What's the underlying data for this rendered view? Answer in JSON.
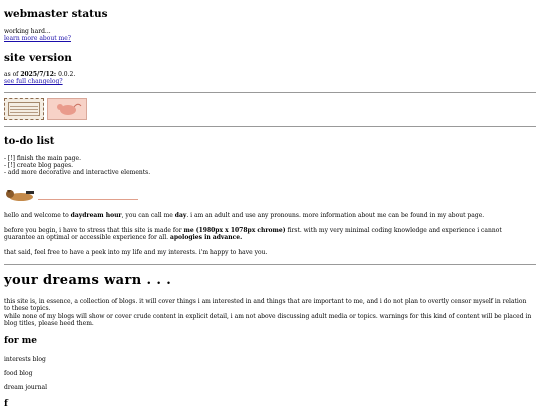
{
  "webmaster": {
    "title": "webmaster status",
    "status": "working hard...",
    "link": "learn more about me?"
  },
  "version": {
    "title": "site version",
    "as_of_prefix": "as of",
    "date": "2025/7/12:",
    "number": "0.0.2.",
    "link": "see full changelog?"
  },
  "badges": [
    {
      "name": "stamp-badge",
      "icon": "postage-stamp"
    },
    {
      "name": "pink-creature-badge",
      "icon": "pink-creature"
    }
  ],
  "todo": {
    "title": "to-do list",
    "items": [
      "- [!] finish the main page.",
      "- [!] create blog pages.",
      "- add more decorative and interactive elements."
    ]
  },
  "intro": {
    "p1_a": "hello and welcome to",
    "p1_b": "daydream hour",
    "p1_c": ", you can call me",
    "p1_d": "day",
    "p1_e": ". i am an adult and use any pronouns. more information about me can be found in my about page.",
    "p2_a": "before you begin, i have to stress that this site is made for",
    "p2_b": "me (1980px x 1078px chrome)",
    "p2_c": "first. with my very minimal coding knowledge and experience i cannot guarantee an optimal or accessible experience for all.",
    "p2_d": "apologies in advance.",
    "p3": "that said, feel free to have a peek into my life and my interests. i'm happy to have you."
  },
  "main": {
    "title": "your dreams warn . . .",
    "p1": "this site is, in essence, a collection of blogs. it will cover things i am interested in and things that are important to me, and i do not plan to overtly censor myself in relation to these topics.",
    "p2": "while none of my blogs will show or cover crude content in explicit detail, i am not above discussing adult media or topics. warnings for this kind of content will be placed in blog titles, please heed them."
  },
  "for_me": {
    "title": "for me",
    "links": [
      "interests blog",
      "food blog",
      "dream journal"
    ]
  },
  "next_heading": "f"
}
